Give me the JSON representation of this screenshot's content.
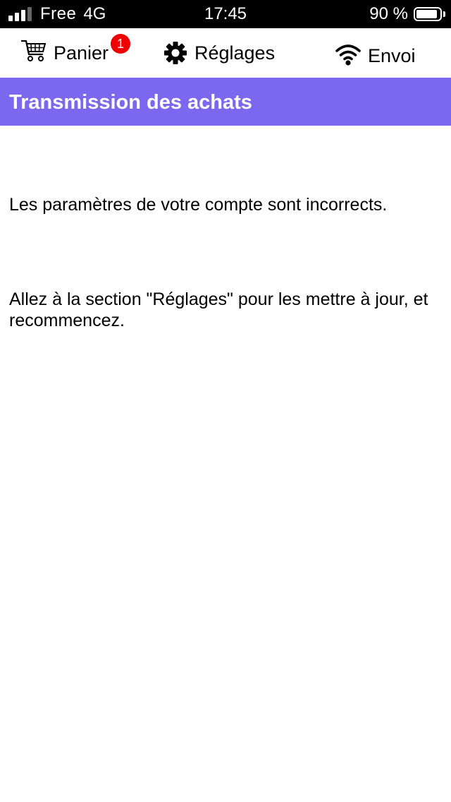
{
  "status_bar": {
    "carrier": "Free",
    "network": "4G",
    "time": "17:45",
    "battery_percent": "90 %",
    "battery_level": 0.9,
    "signal_bars": 3,
    "signal_bars_total": 4
  },
  "toolbar": {
    "cart_label": "Panier",
    "cart_badge": "1",
    "cart_icon": "cart-icon",
    "settings_label": "Réglages",
    "settings_icon": "gear-icon",
    "send_label": "Envoi",
    "send_icon": "wifi-icon",
    "badge_color": "#f00000"
  },
  "header": {
    "title": "Transmission des achats",
    "background_color": "#7b68ee"
  },
  "main": {
    "message_1": "Les paramètres de votre compte sont incorrects.",
    "message_2": "Allez à la section \"Réglages\" pour les mettre à jour, et recommencez."
  }
}
